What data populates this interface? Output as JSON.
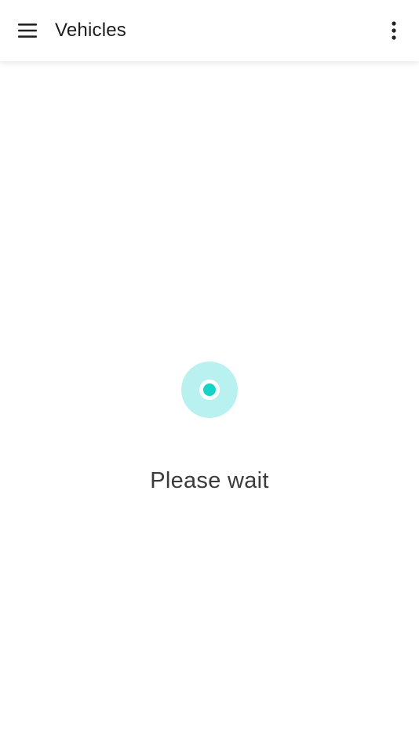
{
  "app_bar": {
    "title": "Vehicles",
    "menu_icon": "hamburger-menu-icon",
    "overflow_icon": "more-vertical-icon"
  },
  "loading": {
    "message": "Please wait",
    "icon": "loading-spinner-icon"
  },
  "colors": {
    "loader_ring": "#b8f1ef",
    "loader_dot": "#16d3c8",
    "title_text": "#1c1c1c",
    "status_text": "#3a3a3a",
    "background": "#ffffff"
  }
}
